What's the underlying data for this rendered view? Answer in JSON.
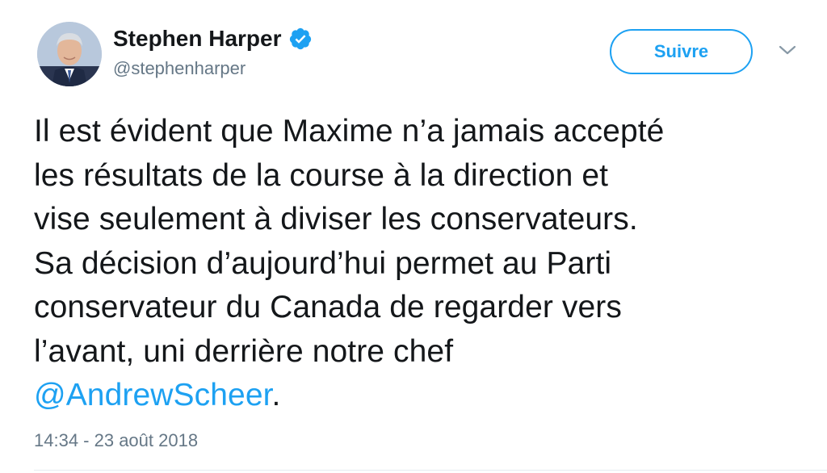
{
  "author": {
    "display_name": "Stephen Harper",
    "handle": "@stephenharper",
    "verified": true,
    "avatar_icon": "profile-photo"
  },
  "actions": {
    "follow_label": "Suivre",
    "menu_icon": "chevron-down-icon"
  },
  "tweet": {
    "lines": [
      "Il est évident que Maxime n’a jamais accepté",
      "les résultats de la course à la direction et",
      "vise seulement à diviser les conservateurs.",
      "Sa décision d’aujourd’hui permet au Parti",
      "conservateur du Canada de regarder vers",
      "l’avant, uni derrière notre chef"
    ],
    "mention": "@AndrewScheer",
    "mention_suffix": ".",
    "timestamp": "14:34 - 23 août 2018"
  },
  "colors": {
    "accent": "#1da1f2",
    "text": "#14171a",
    "secondary": "#657786"
  }
}
